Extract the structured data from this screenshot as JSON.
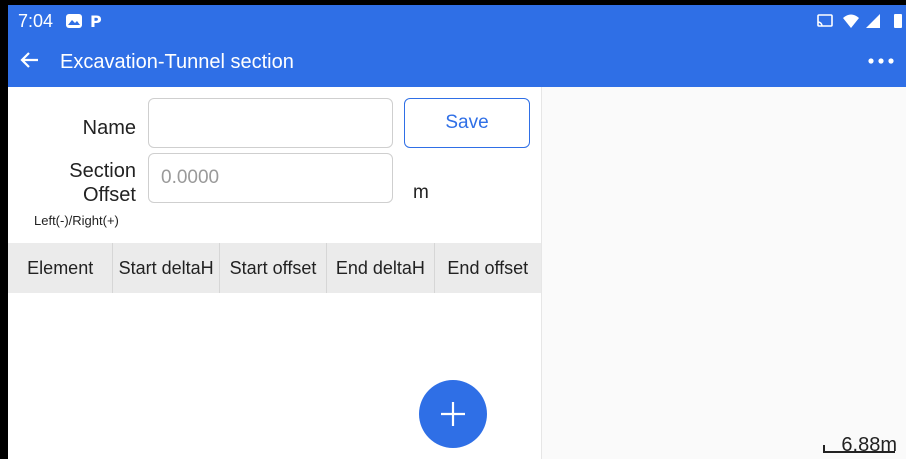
{
  "status_bar": {
    "time": "7:04"
  },
  "app_bar": {
    "title": "Excavation-Tunnel section",
    "back_icon": "arrow-left-icon",
    "more_icon": "overflow-menu-icon"
  },
  "form": {
    "name_label": "Name",
    "name_value": "",
    "save_label": "Save",
    "section_offset_label_1": "Section",
    "section_offset_label_2": "Offset",
    "section_offset_hint": "Left(-)/Right(+)",
    "section_offset_placeholder": "0.0000",
    "unit": "m"
  },
  "table": {
    "columns": [
      "Element",
      "Start deltaH",
      "Start offset",
      "End deltaH",
      "End offset"
    ],
    "rows": []
  },
  "fab": {
    "icon": "plus-icon"
  },
  "preview": {
    "scale_label": "6.88m"
  },
  "colors": {
    "primary": "#2f6fe6",
    "table_header": "#ebebeb"
  }
}
